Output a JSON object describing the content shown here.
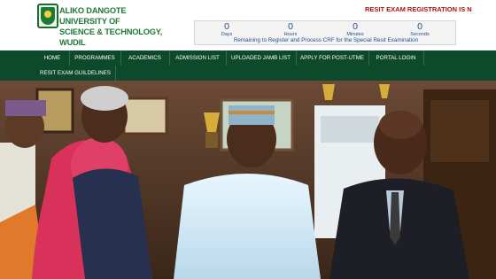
{
  "university": {
    "name_line1": "ALIKO DANGOTE UNIVERSITY OF",
    "name_line2": "SCIENCE & TECHNOLOGY, WUDIL"
  },
  "ticker": {
    "text": "RESIT EXAM REGISTRATION IS N"
  },
  "countdown": {
    "units": [
      {
        "value": "0",
        "label": "Days"
      },
      {
        "value": "0",
        "label": "Hours"
      },
      {
        "value": "0",
        "label": "Minutes"
      },
      {
        "value": "0",
        "label": "Seconds"
      }
    ],
    "message": "Remaining to Register and Process CRF for the Special Resit Examination"
  },
  "nav": {
    "items": [
      {
        "label": "HOME"
      },
      {
        "label": "PROGRAMMES"
      },
      {
        "label": "ACADEMICS"
      },
      {
        "label": "ADMISSION LIST"
      },
      {
        "label": "UPLOADED JAMB LIST"
      },
      {
        "label": "APPLY FOR POST-UTME"
      },
      {
        "label": "PORTAL LOGIN"
      },
      {
        "label": "RESIT EXAM GUILDELINES"
      }
    ]
  },
  "colors": {
    "brand_green": "#1d7a34",
    "nav_bg": "#0c4a2b",
    "ticker_red": "#b01010",
    "countdown_blue": "#1f4f8a"
  },
  "icons": {
    "logo": "university-crest-logo"
  }
}
